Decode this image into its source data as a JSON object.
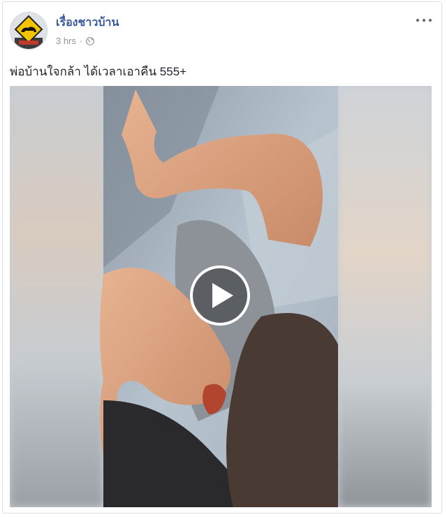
{
  "post": {
    "page_name": "เรื่องชาวบ้าน",
    "timestamp": "3 hrs",
    "separator": "·",
    "privacy_icon": "globe-icon",
    "menu_icon": "more-options-icon",
    "caption": "พ่อบ้านใจกล้า ได้เวลาเอาคืน 555+"
  },
  "avatar": {
    "icon": "road-sign-icon",
    "badge_color": "#f5c400"
  },
  "video": {
    "play_icon": "play-icon"
  },
  "colors": {
    "link": "#365899",
    "meta": "#90949c",
    "text": "#1d2129",
    "border": "#dddfe2"
  }
}
